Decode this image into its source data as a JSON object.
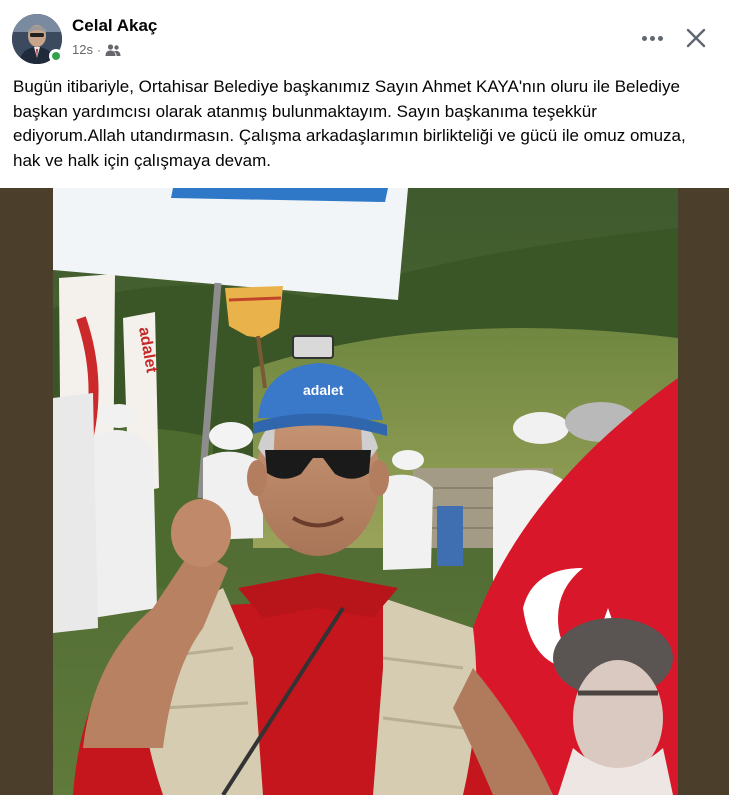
{
  "post": {
    "author": "Celal Akaç",
    "time": "12s",
    "separator": "·",
    "audience_icon": "friends-icon",
    "text": "Bugün itibariyle, Ortahisar Belediye başkanımız Sayın Ahmet KAYA'nın oluru ile Belediye başkan yardımcısı olarak atanmış bulunmaktayım. Sayın başkanıma teşekkür ediyorum.Allah utandırmasın. Çalışma arkadaşlarımın birlikteliği ve gücü ile omuz omuza, hak ve halk için çalışmaya devam."
  },
  "photo": {
    "cap_text": "adalet"
  },
  "colors": {
    "online": "#31a24c",
    "secondary_text": "#65676b",
    "flag_red": "#d8172a",
    "shirt_red": "#c4161c",
    "cap_blue": "#3a78c9"
  }
}
